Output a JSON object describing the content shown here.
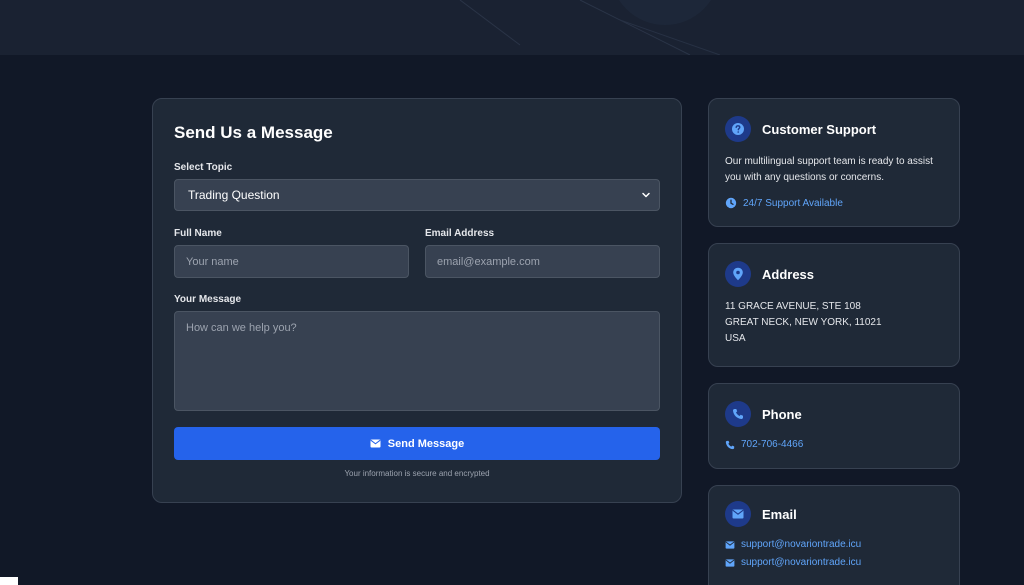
{
  "form": {
    "title": "Send Us a Message",
    "topic_label": "Select Topic",
    "topic_value": "Trading Question",
    "name_label": "Full Name",
    "name_placeholder": "Your name",
    "email_label": "Email Address",
    "email_placeholder": "email@example.com",
    "message_label": "Your Message",
    "message_placeholder": "How can we help you?",
    "send_label": "Send Message",
    "secure_note": "Your information is secure and encrypted"
  },
  "support": {
    "title": "Customer Support",
    "text": "Our multilingual support team is ready to assist you with any questions or concerns.",
    "availability": "24/7 Support Available"
  },
  "address": {
    "title": "Address",
    "line1": "11 GRACE AVENUE, STE 108",
    "line2": "GREAT NECK, NEW YORK, 11021",
    "line3": "USA"
  },
  "phone": {
    "title": "Phone",
    "number": "702-706-4466"
  },
  "email": {
    "title": "Email",
    "addresses": [
      "support@novariontrade.icu",
      "support@novariontrade.icu"
    ]
  },
  "colors": {
    "page_bg": "#111827",
    "card_bg": "#1f2937",
    "accent": "#2563eb",
    "link": "#60a5fa",
    "icon_circle": "#1e3a8a"
  },
  "icons": {
    "support": "question-circle-icon",
    "address": "map-pin-icon",
    "phone": "phone-icon",
    "email": "envelope-icon",
    "clock": "clock-icon",
    "chevron": "chevron-down-icon"
  }
}
